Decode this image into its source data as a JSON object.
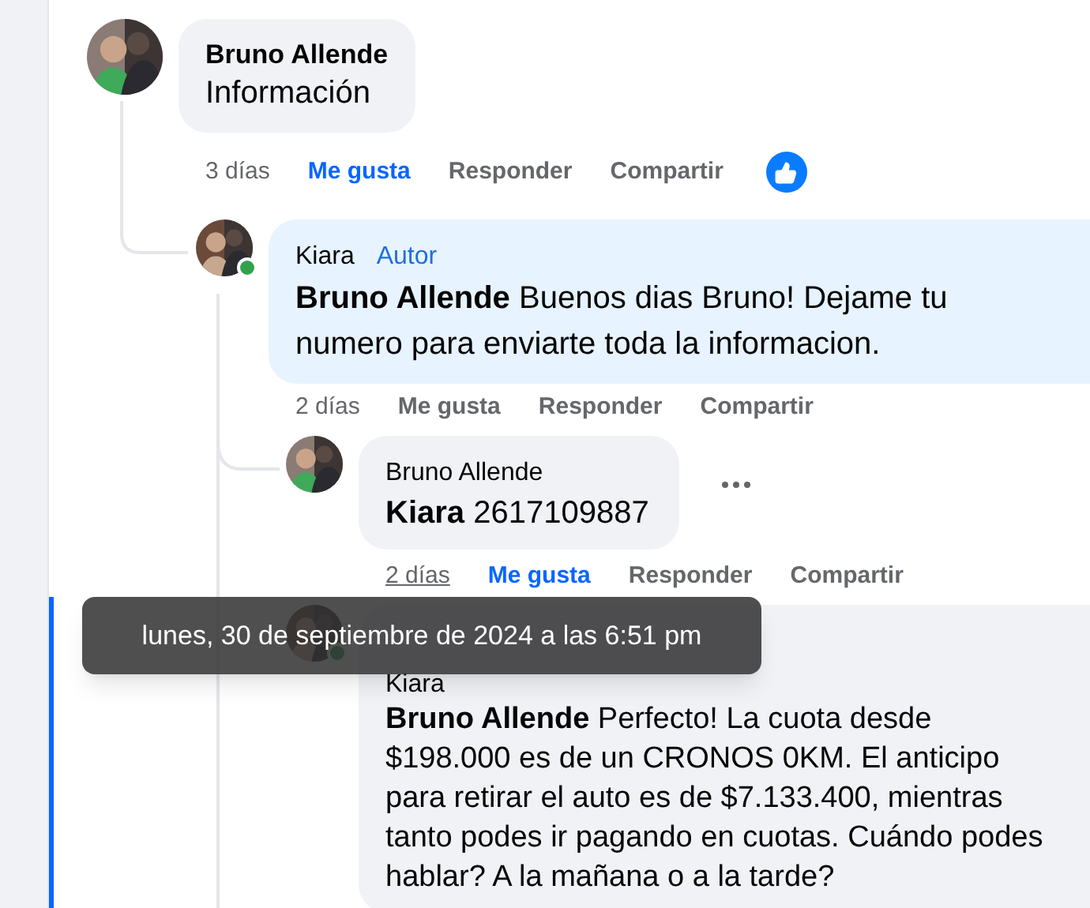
{
  "comments": [
    {
      "author": "Bruno Allende",
      "text": "Información",
      "online": false,
      "highlighted": false,
      "time": "3 días",
      "time_hovered": false,
      "like": "Me gusta",
      "liked": true,
      "reply": "Responder",
      "share": "Compartir",
      "like_reaction": true,
      "menu_visible": false,
      "children": [
        {
          "author": "Kiara",
          "author_badge": "Autor",
          "mention": "Bruno Allende",
          "text": "Buenos dias Bruno! Dejame tu numero para enviarte toda la informacion.",
          "online": true,
          "highlighted": false,
          "time": "2 días",
          "time_hovered": false,
          "like": "Me gusta",
          "liked": false,
          "reply": "Responder",
          "share": "Compartir",
          "like_reaction": false,
          "menu_visible": false,
          "children": [
            {
              "author": "Bruno Allende",
              "mention": "Kiara",
              "text": "2617109887",
              "online": false,
              "highlighted": false,
              "time": "2 días",
              "time_hovered": true,
              "like": "Me gusta",
              "liked": true,
              "reply": "Responder",
              "share": "Compartir",
              "like_reaction": false,
              "menu_visible": true
            },
            {
              "author": "Kiara",
              "mention": "Bruno Allende",
              "text": "Perfecto! La cuota desde $198.000 es de un CRONOS 0KM. El anticipo para retirar el auto es de $7.133.400, mientras tanto podes ir pagando en cuotas. Cuándo podes hablar? A la mañana o a la tarde?",
              "online": true,
              "highlighted": true
            }
          ]
        }
      ]
    }
  ],
  "tooltip": {
    "text": "lunes, 30 de septiembre de 2024 a las 6:51 pm"
  }
}
